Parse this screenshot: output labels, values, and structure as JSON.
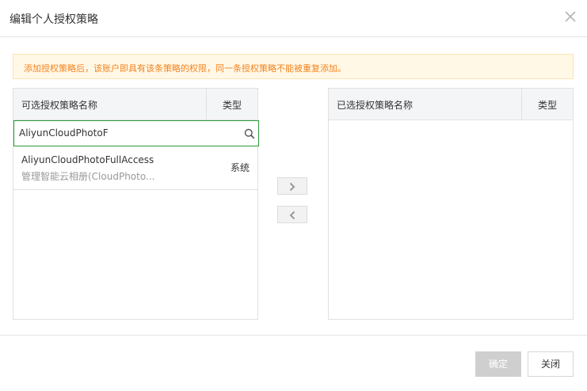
{
  "dialog": {
    "title": "编辑个人授权策略",
    "close_icon": "close-icon"
  },
  "notice": {
    "text": "添加授权策略后，该账户即具有该条策略的权限，同一条授权策略不能被重复添加。",
    "color": "#f5831f",
    "background": "#fff8e6"
  },
  "left_panel": {
    "name_header": "可选授权策略名称",
    "type_header": "类型",
    "search": {
      "value": "AliyunCloudPhotoF",
      "icon": "search-icon",
      "border_color": "#2b9939"
    },
    "items": [
      {
        "name": "AliyunCloudPhotoFullAccess",
        "description": "管理智能云相册(CloudPhoto...",
        "type": "系统"
      }
    ]
  },
  "right_panel": {
    "name_header": "已选授权策略名称",
    "type_header": "类型"
  },
  "transfer": {
    "add_icon": "chevron-right-icon",
    "remove_icon": "chevron-left-icon"
  },
  "footer": {
    "ok_label": "确定",
    "cancel_label": "关闭"
  }
}
